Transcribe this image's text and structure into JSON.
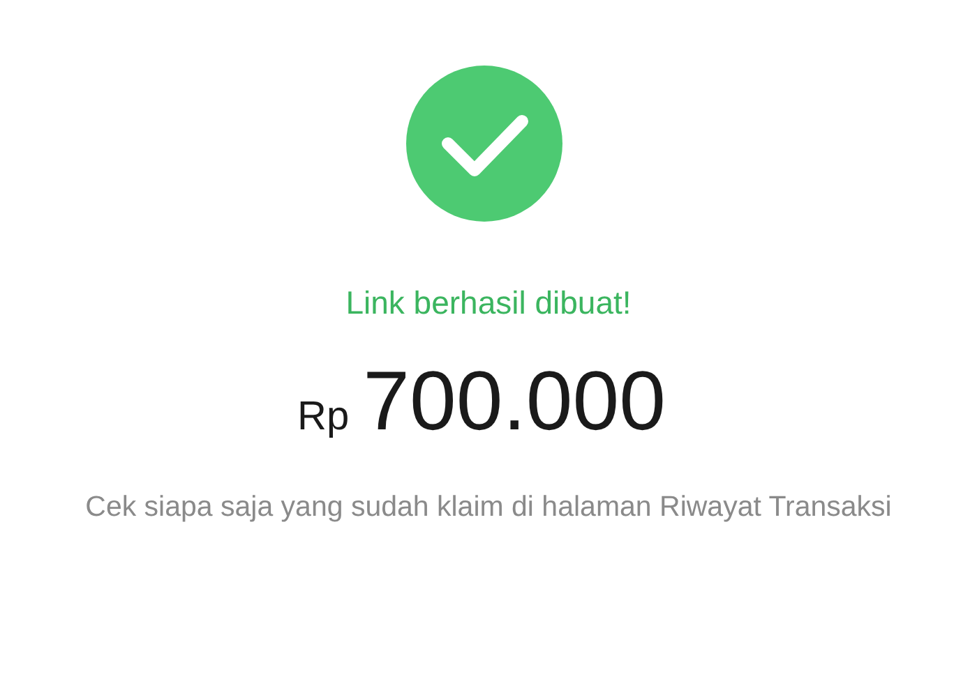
{
  "status": {
    "title": "Link berhasil dibuat!"
  },
  "amount": {
    "currency": "Rp",
    "value": "700.000"
  },
  "note": "Cek siapa saja yang sudah klaim di halaman Riwayat Transaksi"
}
